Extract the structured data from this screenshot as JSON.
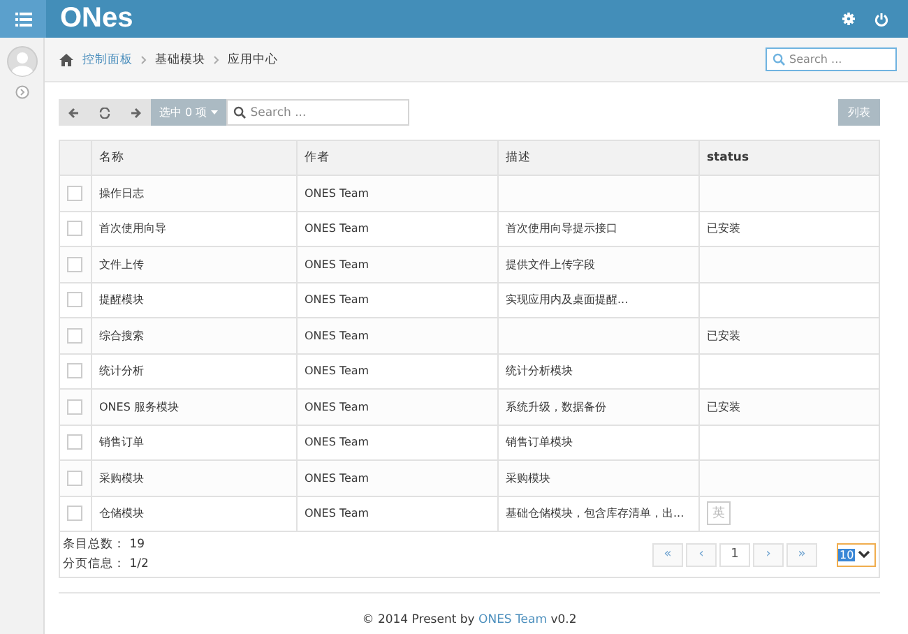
{
  "header": {
    "logo": "ONes"
  },
  "breadcrumb": [
    "控制面板",
    "基础模块",
    "应用中心"
  ],
  "top_search": {
    "placeholder": "Search ..."
  },
  "toolbar": {
    "selected_button": "选中 0 项",
    "search": {
      "placeholder": "Search ..."
    },
    "view_button": "列表"
  },
  "table": {
    "columns": [
      "名称",
      "作者",
      "描述",
      "status"
    ],
    "rows": [
      {
        "checked": false,
        "cells": [
          "操作日志",
          "ONES Team",
          "",
          ""
        ]
      },
      {
        "checked": false,
        "cells": [
          "首次使用向导",
          "ONES Team",
          "首次使用向导提示接口",
          "已安装"
        ]
      },
      {
        "checked": false,
        "cells": [
          "文件上传",
          "ONES Team",
          "提供文件上传字段",
          ""
        ]
      },
      {
        "checked": false,
        "cells": [
          "提醒模块",
          "ONES Team",
          "实现应用内及桌面提醒...",
          ""
        ]
      },
      {
        "checked": false,
        "cells": [
          "综合搜索",
          "ONES Team",
          "",
          "已安装"
        ]
      },
      {
        "checked": false,
        "cells": [
          "统计分析",
          "ONES Team",
          "统计分析模块",
          ""
        ]
      },
      {
        "checked": false,
        "cells": [
          "ONES 服务模块",
          "ONES Team",
          "系统升级，数据备份",
          "已安装"
        ]
      },
      {
        "checked": false,
        "cells": [
          "销售订单",
          "ONES Team",
          "销售订单模块",
          ""
        ]
      },
      {
        "checked": false,
        "cells": [
          "采购模块",
          "ONES Team",
          "采购模块",
          ""
        ]
      },
      {
        "checked": false,
        "cells": [
          "仓储模块",
          "ONES Team",
          "基础仓储模块，包含库存清单，出...",
          ""
        ]
      }
    ]
  },
  "ime_indicator": "英",
  "summary": [
    "条目总数： 19",
    "分页信息： 1/2"
  ],
  "pagination": [
    "«",
    "‹",
    "1",
    "›",
    "»"
  ],
  "page_size": "10",
  "footer": {
    "text": "© 2014 Present by ",
    "link": "ONES Team",
    "version": " v0.2"
  }
}
